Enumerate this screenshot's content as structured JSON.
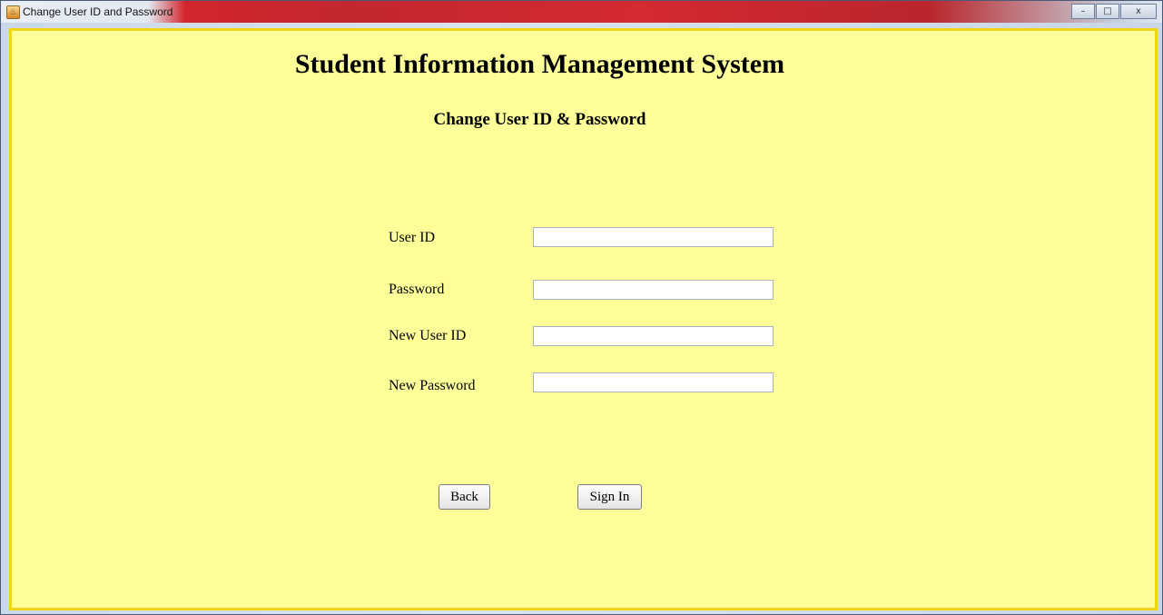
{
  "window": {
    "title": "Change User ID and Password",
    "icon": "java-icon",
    "controls": {
      "minimize": "–",
      "maximize": "□",
      "close": "x"
    }
  },
  "header": {
    "title": "Student Information Management System",
    "subtitle": "Change User ID & Password"
  },
  "form": {
    "user_id": {
      "label": "User ID",
      "value": "",
      "placeholder": ""
    },
    "password": {
      "label": "Password",
      "value": "",
      "placeholder": ""
    },
    "new_user_id": {
      "label": "New User ID",
      "value": "",
      "placeholder": ""
    },
    "new_password": {
      "label": "New Password",
      "value": "",
      "placeholder": ""
    }
  },
  "actions": {
    "back_label": "Back",
    "sign_in_label": "Sign In"
  },
  "colors": {
    "background": "#ffff99",
    "border": "#f2d21a",
    "titlebar": "#d42a30"
  }
}
